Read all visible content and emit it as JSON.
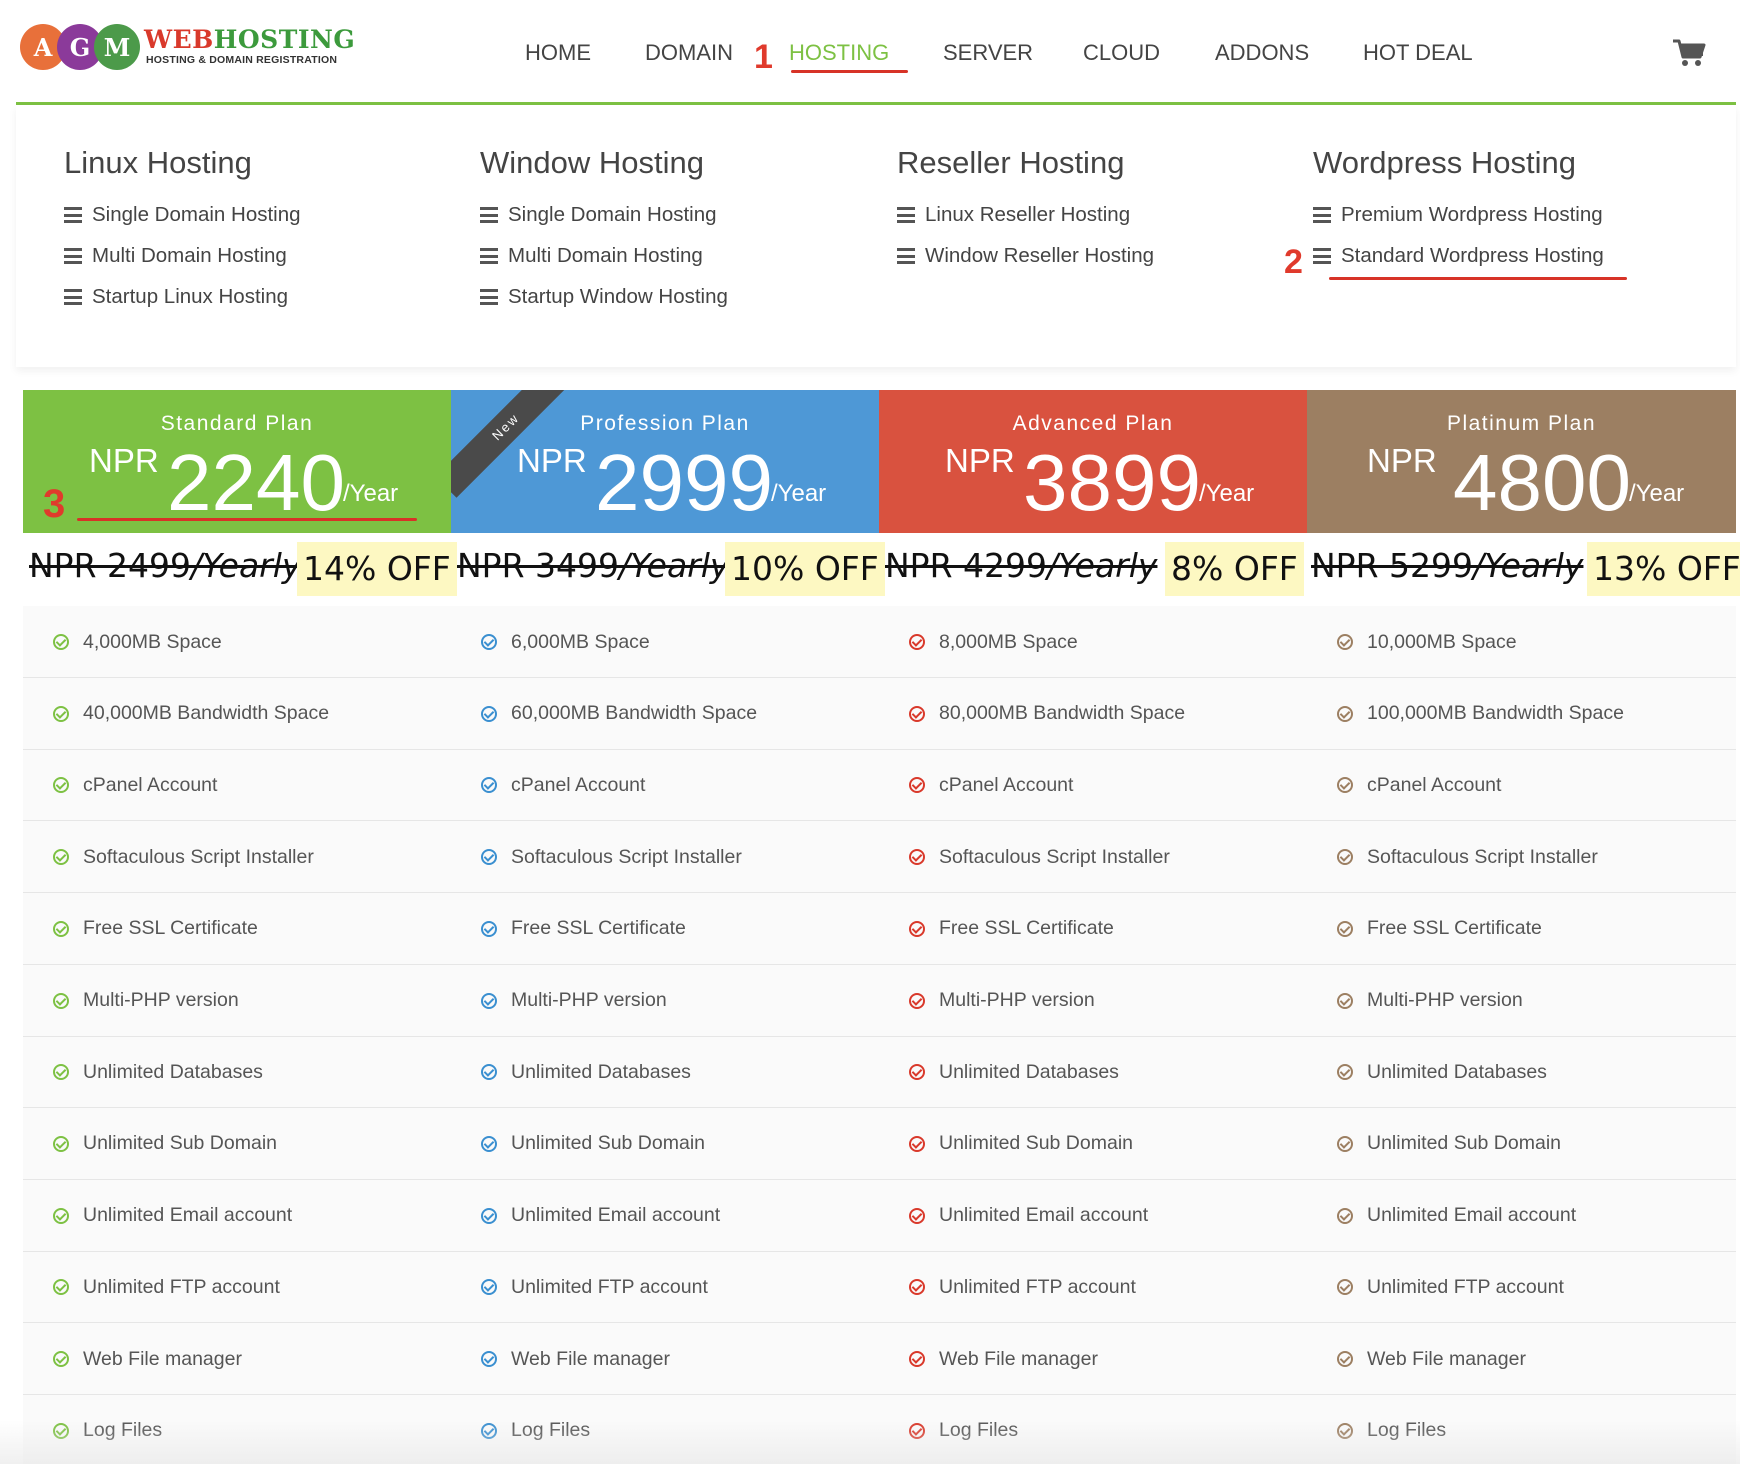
{
  "logo": {
    "letters": [
      "A",
      "G",
      "M"
    ],
    "name_part1": "WEB",
    "name_part2": "HOSTING",
    "tagline": "HOSTING & DOMAIN REGISTRATION"
  },
  "nav": {
    "items": [
      {
        "label": "HOME"
      },
      {
        "label": "DOMAIN"
      },
      {
        "label": "HOSTING",
        "active": true
      },
      {
        "label": "SERVER"
      },
      {
        "label": "CLOUD"
      },
      {
        "label": "ADDONS"
      },
      {
        "label": "HOT DEAL"
      }
    ],
    "cart_icon": "shopping-cart-icon"
  },
  "annotations": {
    "step1": "1",
    "step2": "2",
    "step3": "3"
  },
  "mega_menu": {
    "columns": [
      {
        "title": "Linux Hosting",
        "links": [
          "Single Domain Hosting",
          "Multi Domain Hosting",
          "Startup Linux Hosting"
        ]
      },
      {
        "title": "Window Hosting",
        "links": [
          "Single Domain Hosting",
          "Multi Domain Hosting",
          "Startup Window Hosting"
        ]
      },
      {
        "title": "Reseller Hosting",
        "links": [
          "Linux Reseller Hosting",
          "Window Reseller Hosting"
        ]
      },
      {
        "title": "Wordpress Hosting",
        "links": [
          "Premium Wordpress Hosting",
          "Standard Wordpress Hosting"
        ]
      }
    ]
  },
  "plans": [
    {
      "name": "Standard Plan",
      "currency": "NPR",
      "price": "2240",
      "period": "/Year",
      "old_price": "NPR 2499",
      "old_period": "/Yearly",
      "discount": "14% OFF",
      "color": "#7dc143",
      "check_color": "#7dc143"
    },
    {
      "name": "Profession Plan",
      "currency": "NPR",
      "price": "2999",
      "period": "/Year",
      "old_price": "NPR 3499",
      "old_period": "/Yearly",
      "discount": "10% OFF",
      "color": "#4e98d6",
      "check_color": "#3a8fd0",
      "ribbon": "New"
    },
    {
      "name": "Advanced Plan",
      "currency": "NPR",
      "price": "3899",
      "period": "/Year",
      "old_price": "NPR 4299",
      "old_period": "/Yearly",
      "discount": "8% OFF",
      "color": "#d9523f",
      "check_color": "#d9392b"
    },
    {
      "name": "Platinum Plan",
      "currency": "NPR",
      "price": "4800",
      "period": "/Year",
      "old_price": "NPR 5299",
      "old_period": "/Yearly",
      "discount": "13% OFF",
      "color": "#9c7f62",
      "check_color": "#9c7f62"
    }
  ],
  "features": [
    [
      "4,000MB Space",
      "6,000MB Space",
      "8,000MB Space",
      "10,000MB Space"
    ],
    [
      "40,000MB Bandwidth Space",
      "60,000MB Bandwidth Space",
      "80,000MB Bandwidth Space",
      "100,000MB Bandwidth Space"
    ],
    [
      "cPanel Account",
      "cPanel Account",
      "cPanel Account",
      "cPanel Account"
    ],
    [
      "Softaculous Script Installer",
      "Softaculous Script Installer",
      "Softaculous Script Installer",
      "Softaculous Script Installer"
    ],
    [
      "Free SSL Certificate",
      "Free SSL Certificate",
      "Free SSL Certificate",
      "Free SSL Certificate"
    ],
    [
      "Multi-PHP version",
      "Multi-PHP version",
      "Multi-PHP version",
      "Multi-PHP version"
    ],
    [
      "Unlimited Databases",
      "Unlimited Databases",
      "Unlimited Databases",
      "Unlimited Databases"
    ],
    [
      "Unlimited Sub Domain",
      "Unlimited Sub Domain",
      "Unlimited Sub Domain",
      "Unlimited Sub Domain"
    ],
    [
      "Unlimited Email account",
      "Unlimited Email account",
      "Unlimited Email account",
      "Unlimited Email account"
    ],
    [
      "Unlimited FTP account",
      "Unlimited FTP account",
      "Unlimited FTP account",
      "Unlimited FTP account"
    ],
    [
      "Web File manager",
      "Web File manager",
      "Web File manager",
      "Web File manager"
    ],
    [
      "Log Files",
      "Log Files",
      "Log Files",
      "Log Files"
    ]
  ],
  "colors": {
    "accent_green": "#7dc143",
    "annotation_red": "#e03a2c"
  }
}
